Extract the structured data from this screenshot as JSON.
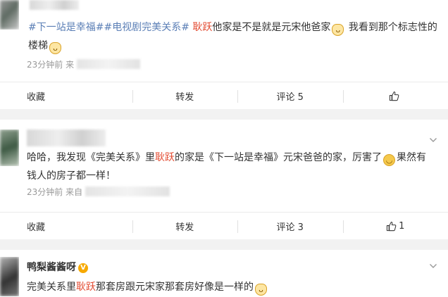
{
  "posts": [
    {
      "tags": [
        "#下一站是幸福#",
        "#电视剧完美关系#"
      ],
      "name_hl": "耿跃",
      "text_a": "他家是不是就是元宋他爸家",
      "text_b": " 我看到那个标志性的",
      "text_c": "楼梯",
      "time": "23分钟前",
      "source_prefix": "来",
      "actions": {
        "collect": "收藏",
        "repost": "转发",
        "comment": "评论 5",
        "like": ""
      }
    },
    {
      "text_a": "哈哈，我发现《完美关系》里",
      "name_hl": "耿跃",
      "text_b": "的家是《下一站是幸福》元宋爸爸的家，厉害了",
      "text_c": "果然有",
      "text_d": "钱人的房子都一样！",
      "time": "23分钟前",
      "source_prefix": "来自",
      "actions": {
        "collect": "收藏",
        "repost": "转发",
        "comment": "评论 3",
        "like": "1"
      }
    },
    {
      "username": "鸭梨酱酱呀",
      "badge": "V",
      "text_a": "完美关系里",
      "name_hl": "耿跃",
      "text_b": "那套房跟元宋家那套房好像是一样的"
    }
  ],
  "icons": [
    "thumbs-up-icon",
    "chevron-down-icon",
    "cat-emoji-icon",
    "smile-emoji-icon"
  ]
}
